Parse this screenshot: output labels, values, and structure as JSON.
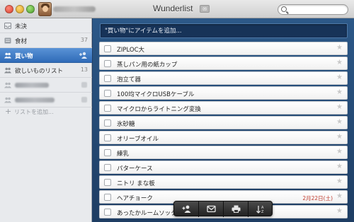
{
  "window": {
    "title": "Wunderlist",
    "search_placeholder": ""
  },
  "sidebar": {
    "items": [
      {
        "label": "未決",
        "count": "",
        "icon": "inbox-icon"
      },
      {
        "label": "食材",
        "count": "37",
        "icon": "list-icon"
      },
      {
        "label": "買い物",
        "count": "",
        "icon": "shared-list-icon",
        "active": true
      },
      {
        "label": "欲しいものリスト",
        "count": "13",
        "icon": "shared-list-icon"
      }
    ],
    "add_list_label": "リストを追加..."
  },
  "main": {
    "add_placeholder": "\"買い物\"にアイテムを追加...",
    "tasks": [
      {
        "title": "ZIPLOC大",
        "due": ""
      },
      {
        "title": "蒸しパン用の紙カップ",
        "due": ""
      },
      {
        "title": "泡立て器",
        "due": ""
      },
      {
        "title": "100均マイクロUSBケーブル",
        "due": ""
      },
      {
        "title": "マイクロからライトニング変換",
        "due": ""
      },
      {
        "title": "氷砂糖",
        "due": ""
      },
      {
        "title": "オリーブオイル",
        "due": ""
      },
      {
        "title": "練乳",
        "due": ""
      },
      {
        "title": "パターケース",
        "due": ""
      },
      {
        "title": "ニトリ まな板",
        "due": ""
      },
      {
        "title": "ヘアチョーク",
        "due": "2月22日(土)"
      },
      {
        "title": "あったかルームソック",
        "due": ""
      }
    ]
  },
  "toolbar": {
    "buttons": [
      "share-list-icon",
      "email-icon",
      "print-icon",
      "sort-icon"
    ]
  },
  "colors": {
    "accent": "#2f6bb8",
    "background": "#1f3e66",
    "due_date": "#c0392b"
  }
}
